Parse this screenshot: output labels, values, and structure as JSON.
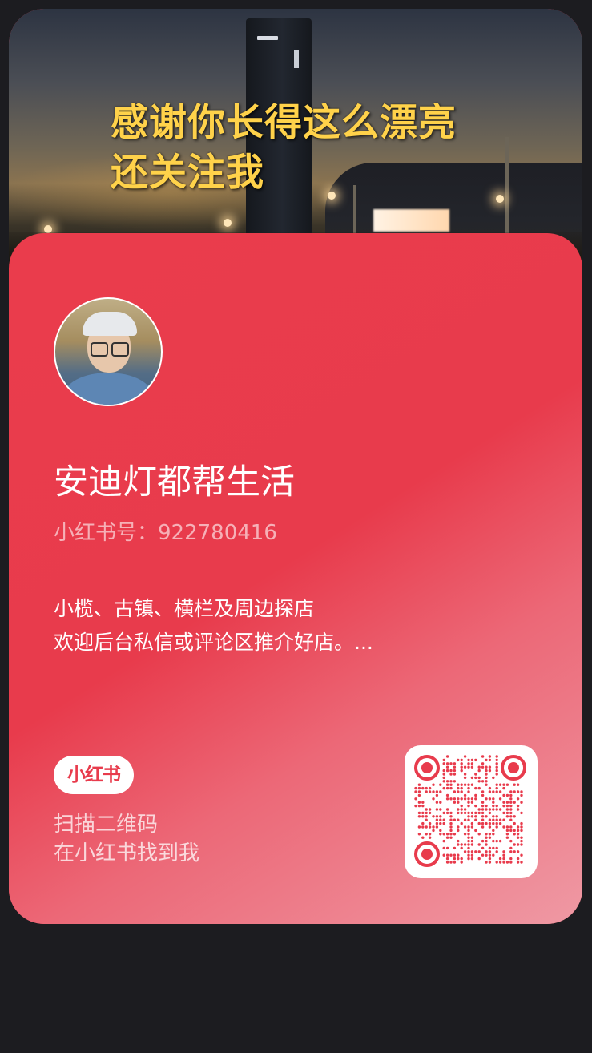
{
  "cover": {
    "line1": "感谢你长得这么漂亮",
    "line2": "还关注我"
  },
  "profile": {
    "name": "安迪灯都帮生活",
    "id_label": "小红书号：",
    "id_value": "922780416",
    "bio_line1": "小榄、古镇、横栏及周边探店",
    "bio_line2": "欢迎后台私信或评论区推介好店。..."
  },
  "footer": {
    "logo_text": "小红书",
    "scan_line1": "扫描二维码",
    "scan_line2": "在小红书找到我"
  },
  "colors": {
    "brand": "#e83b4c",
    "page_bg": "#1c1c20",
    "cover_text": "#ffd24a"
  },
  "icons": {
    "qr": "qr-code-icon",
    "logo": "xiaohongshu-logo"
  }
}
